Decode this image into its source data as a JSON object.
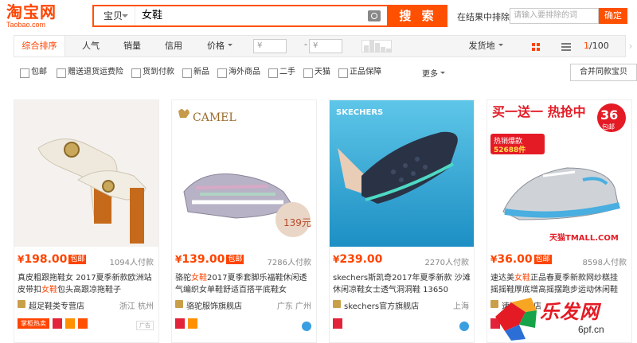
{
  "header": {
    "logo_cn": "淘宝网",
    "logo_en": "Taobao.com",
    "search_scope": "宝贝",
    "search_query": "女鞋",
    "search_button": "搜 索",
    "within_results_label": "在结果中排除",
    "within_results_placeholder": "请输入要排除的词",
    "within_results_button": "确定"
  },
  "sortbar": {
    "tabs": [
      "综合排序",
      "人气",
      "销量",
      "信用",
      "价格"
    ],
    "price_from_placeholder": "¥",
    "price_to_placeholder": "¥",
    "price_dash": "-",
    "ship_from": "发货地",
    "page_current": "1",
    "page_total": "/100",
    "prev": "‹",
    "next": "›"
  },
  "filters": {
    "items": [
      "包邮",
      "赠送退货运费险",
      "货到付款",
      "新品",
      "海外商品",
      "二手",
      "天猫",
      "正品保障"
    ],
    "more": "更多",
    "combine_button": "合并同款宝贝"
  },
  "products": [
    {
      "price": "198.00",
      "sales": "1094人付款",
      "title_a": "真皮粗跟拖鞋女 2017夏季新款欧洲站",
      "title_b": "皮带扣",
      "title_hl": "女鞋",
      "title_c": "包头高跟凉拖鞋子",
      "shop": "超足鞋类专营店",
      "location": "浙江 杭州",
      "badge": "掌柜热卖",
      "ad": "广告"
    },
    {
      "price": "139.00",
      "sales": "7286人付款",
      "title_a": "骆驼",
      "title_hl": "女鞋",
      "title_b": "2017夏季套脚乐福鞋休闲透",
      "title_c": "气编织女单鞋舒适百搭平底鞋女",
      "shop": "骆驼服饰旗舰店",
      "location": "广东 广州",
      "brand_text": "CAMEL",
      "promo_price": "139元"
    },
    {
      "price": "239.00",
      "sales": "2270人付款",
      "title_a": "skechers斯凯奇2017年夏季新款 沙滩",
      "title_b": "休闲凉鞋女士透气洞洞鞋 13650",
      "shop": "skechers官方旗舰店",
      "location": "上海",
      "brand_text": "SKECHERS"
    },
    {
      "price": "36.00",
      "sales": "8598人付款",
      "title_a": "速达美",
      "title_hl": "女鞋",
      "title_b": "正品春夏季新款网纱糕挂",
      "title_c": "摇摇鞋厚底增高摇摆跑步运动休闲鞋",
      "shop": "速达美鞋店",
      "banner": "买一送一 热抢中",
      "sold_tag": "热销爆款",
      "sold_count": "52688件",
      "price_tag": "36",
      "price_tag_unit": "包邮",
      "tmall": "天猫TMALL.COM"
    }
  ],
  "watermark": {
    "text": "乐发网",
    "url": "6pf.cn"
  }
}
